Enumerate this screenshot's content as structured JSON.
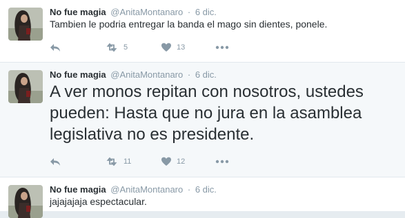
{
  "tweets": [
    {
      "name": "No fue magia",
      "handle": "@AnitaMontanaro",
      "sep": "·",
      "date": "6 dic.",
      "text": "Tambien le podria entregar la banda el mago sin dientes, ponele.",
      "retweets": "5",
      "likes": "13"
    },
    {
      "name": "No fue magia",
      "handle": "@AnitaMontanaro",
      "sep": "·",
      "date": "6 dic.",
      "text": "A ver monos repitan con nosotros, ustedes pueden: Hasta que no jura en la asamblea legislativa no es presidente.",
      "retweets": "11",
      "likes": "12"
    },
    {
      "name": "No fue magia",
      "handle": "@AnitaMontanaro",
      "sep": "·",
      "date": "6 dic.",
      "text": "jajajajaja espectacular."
    }
  ],
  "colors": {
    "icon": "#8899a6",
    "text": "#292f33",
    "muted": "#8899a6",
    "highlight_bg": "#f5f8fa"
  },
  "icons": [
    "reply-icon",
    "retweet-icon",
    "heart-icon",
    "more-icon"
  ]
}
